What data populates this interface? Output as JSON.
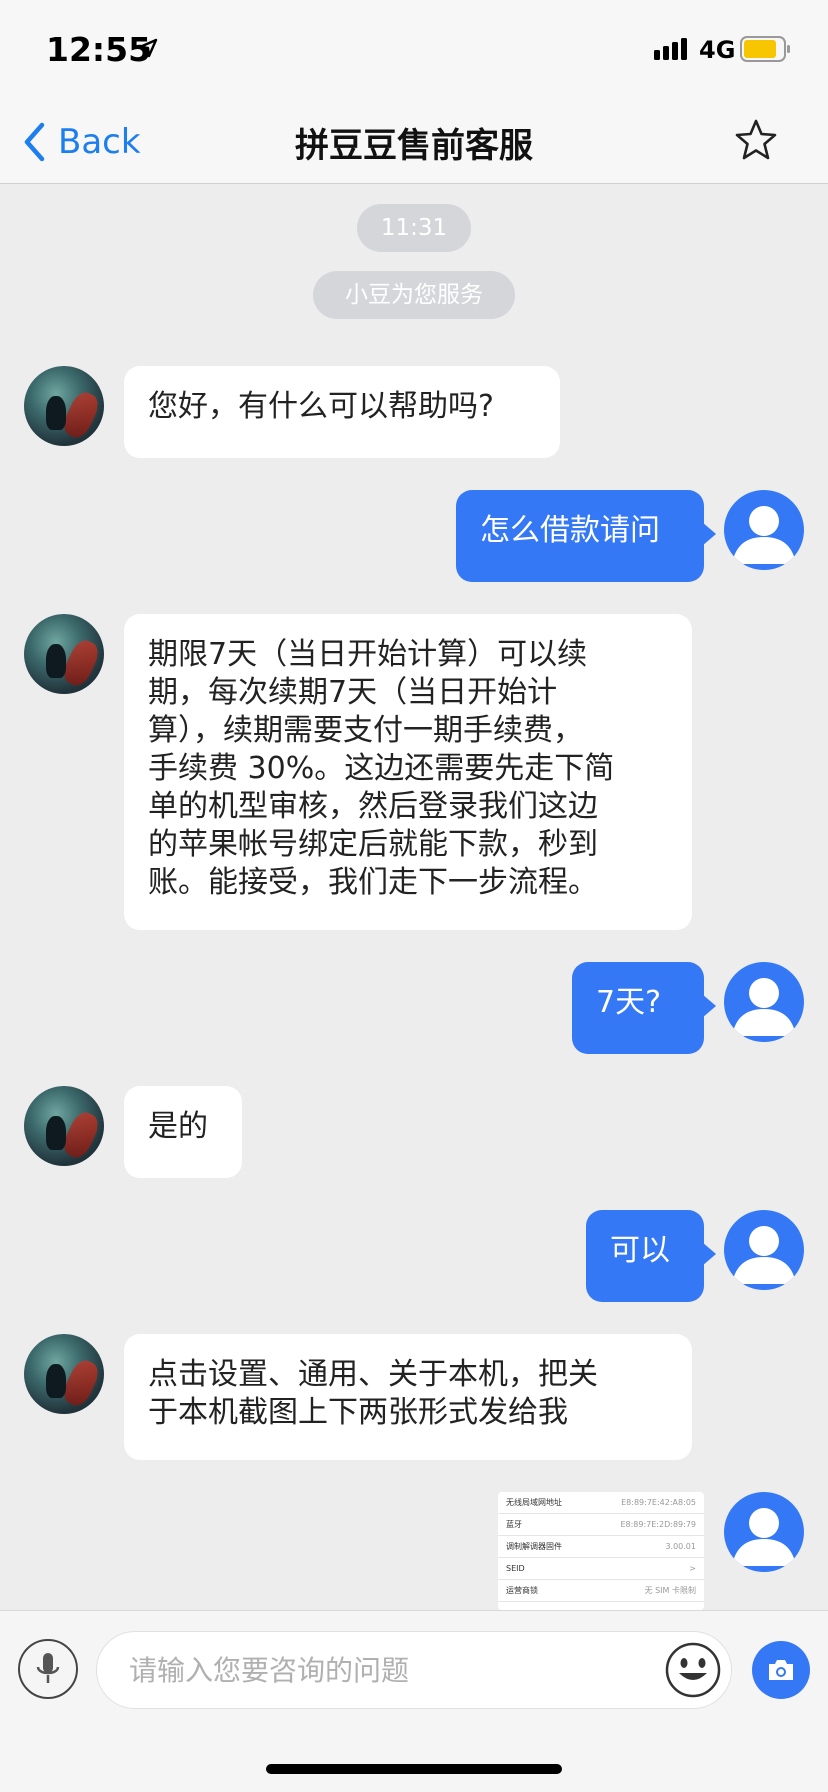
{
  "status_bar": {
    "time": "12:55",
    "network": "4G"
  },
  "nav": {
    "back_label": "Back",
    "title": "拼豆豆售前客服"
  },
  "chat": {
    "timestamp": "11:31",
    "system_notice": "小豆为您服务",
    "messages": [
      {
        "from": "agent",
        "text": "您好，有什么可以帮助吗?"
      },
      {
        "from": "user",
        "text": "怎么借款请问"
      },
      {
        "from": "agent",
        "lines": [
          "期限7天（当日开始计算）可以续",
          "期，每次续期7天（当日开始计",
          "算），续期需要支付一期手续费，",
          "手续费 30%。这边还需要先走下简",
          "单的机型审核，然后登录我们这边",
          "的苹果帐号绑定后就能下款，秒到",
          "账。能接受，我们走下一步流程。"
        ]
      },
      {
        "from": "user",
        "text": "7天?"
      },
      {
        "from": "agent",
        "text": "是的"
      },
      {
        "from": "user",
        "text": "可以"
      },
      {
        "from": "agent",
        "lines": [
          "点击设置、通用、关于本机，把关",
          "于本机截图上下两张形式发给我"
        ]
      }
    ],
    "screenshot_rows": [
      {
        "label": "无线局域网地址",
        "value": "E8:89:7E:42:A8:05"
      },
      {
        "label": "蓝牙",
        "value": "E8:89:7E:2D:89:79"
      },
      {
        "label": "调制解调器固件",
        "value": "3.00.01"
      },
      {
        "label": "SEID",
        "value": ">"
      },
      {
        "label": "运营商锁",
        "value": "无 SIM 卡限制"
      }
    ]
  },
  "input": {
    "placeholder": "请输入您要咨询的问题"
  },
  "colors": {
    "accent": "#3478f6",
    "background": "#ededed",
    "battery": "#f7c600"
  }
}
